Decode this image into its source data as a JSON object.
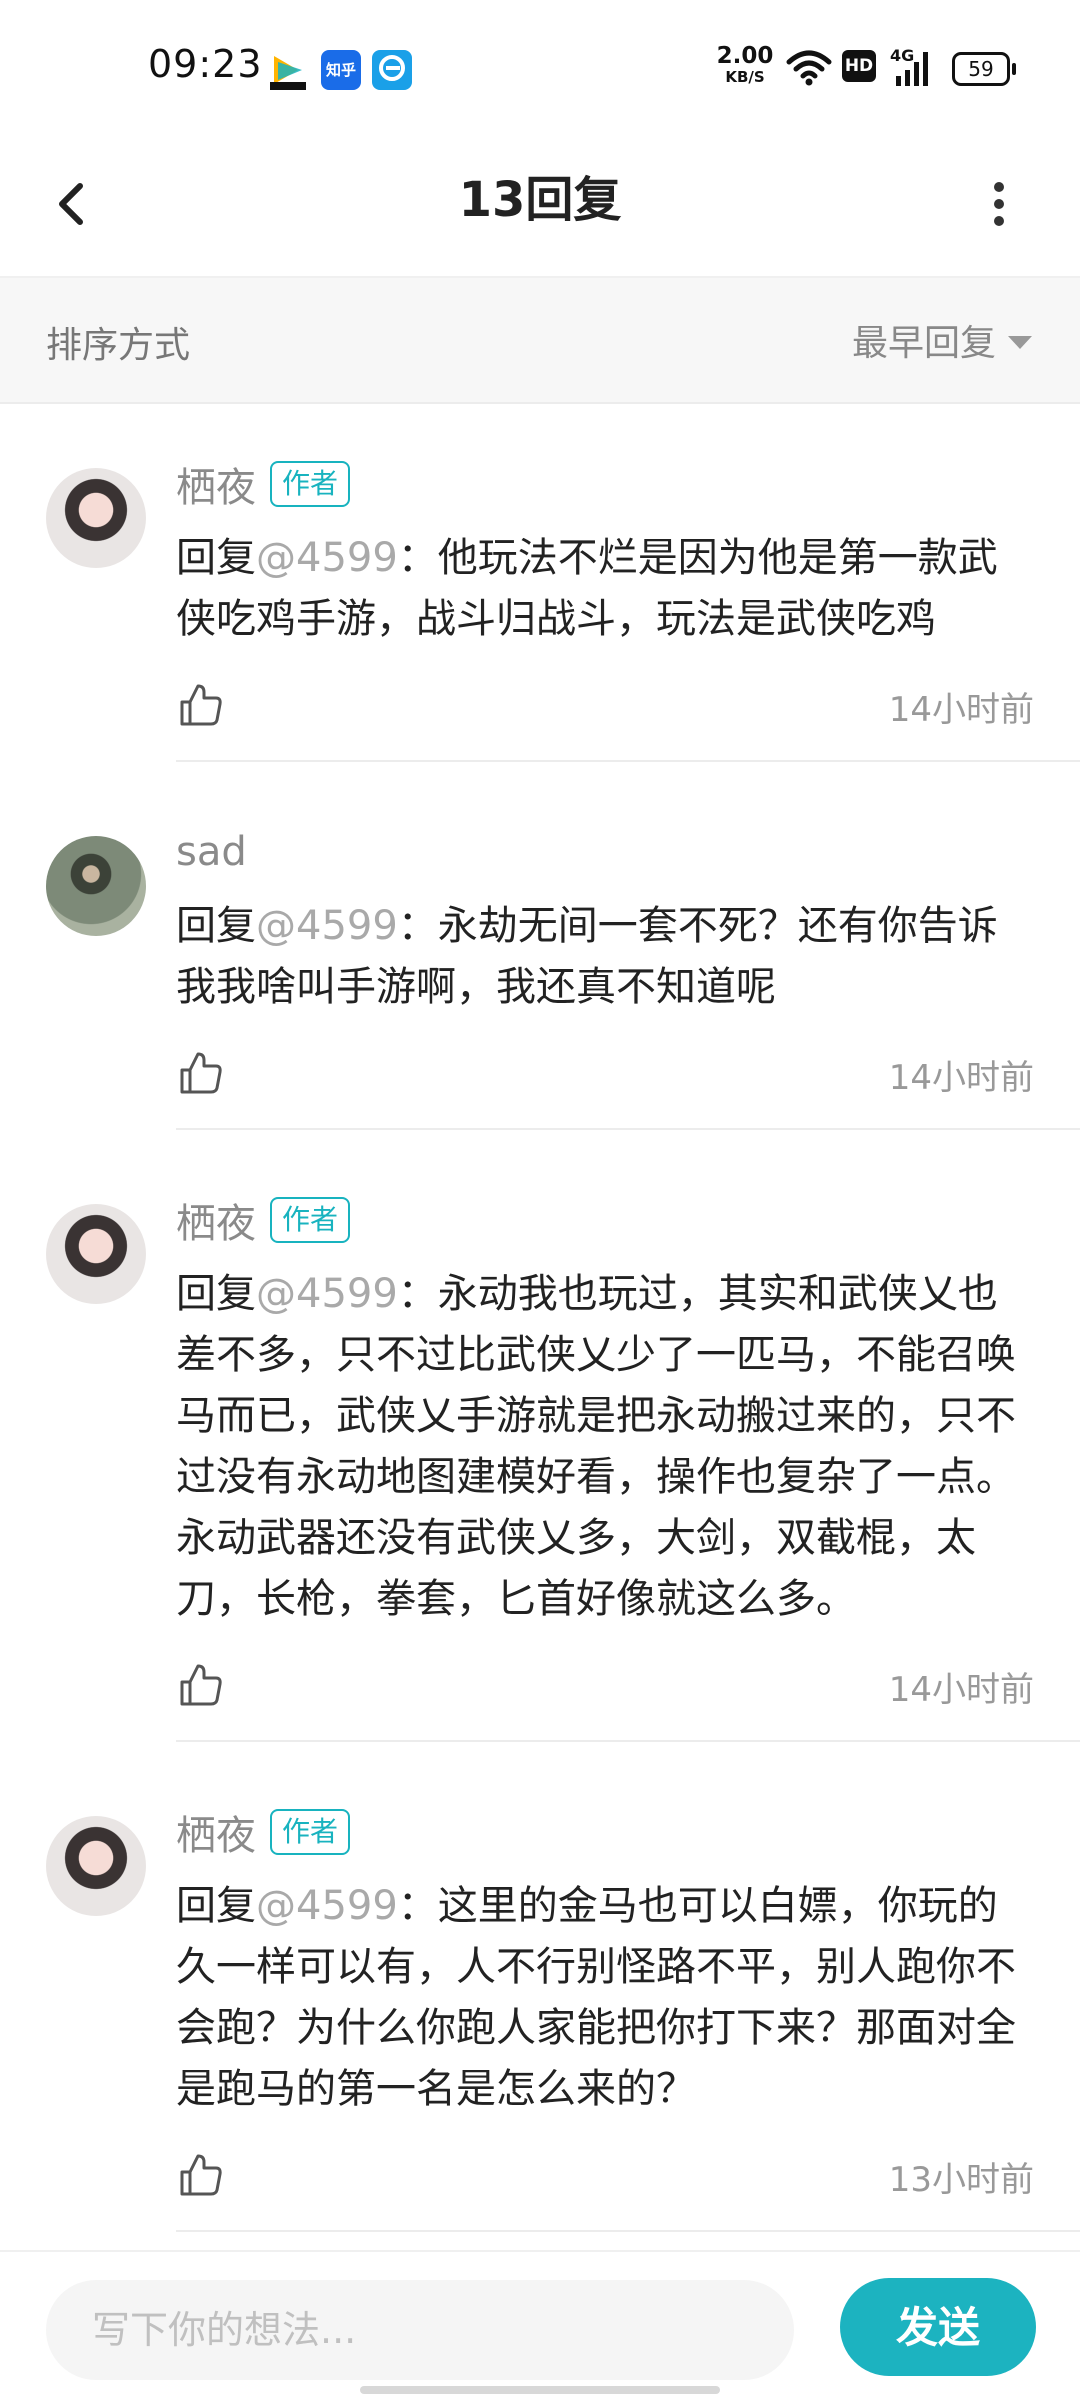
{
  "status_bar": {
    "time": "09:23",
    "apps": [
      {
        "icon": "video-app-icon"
      },
      {
        "icon": "zhihu-app-icon",
        "label": "知乎"
      },
      {
        "icon": "browser-app-icon"
      }
    ],
    "net_speed": "2.00",
    "net_unit": "KB/S",
    "hd": "HD",
    "signal": "4G",
    "battery": "59"
  },
  "header": {
    "title": "13回复",
    "back_icon": "back-arrow-icon",
    "more_icon": "more-vertical-icon"
  },
  "sort": {
    "label": "排序方式",
    "value": "最早回复"
  },
  "comments": [
    {
      "username": "栖夜",
      "badge": "作者",
      "reply_prefix": "回复",
      "mention": "@4599",
      "text": "：他玩法不烂是因为他是第一款武侠吃鸡手游，战斗归战斗，玩法是武侠吃鸡",
      "time": "14小时前"
    },
    {
      "username": "sad",
      "badge": "",
      "reply_prefix": "回复",
      "mention": "@4599",
      "text": "：永劫无间一套不死？还有你告诉我我啥叫手游啊，我还真不知道呢",
      "time": "14小时前"
    },
    {
      "username": "栖夜",
      "badge": "作者",
      "reply_prefix": "回复",
      "mention": "@4599",
      "text": "：永动我也玩过，其实和武侠乂也差不多，只不过比武侠乂少了一匹马，不能召唤马而已，武侠乂手游就是把永动搬过来的，只不过没有永动地图建模好看，操作也复杂了一点。永动武器还没有武侠乂多，大剑，双截棍，太刀，长枪，拳套，匕首好像就这么多。",
      "time": "14小时前"
    },
    {
      "username": "栖夜",
      "badge": "作者",
      "reply_prefix": "回复",
      "mention": "@4599",
      "text": "：这里的金马也可以白嫖，你玩的久一样可以有，人不行别怪路不平，别人跑你不会跑？为什么你跑人家能把你打下来？那面对全是跑马的第一名是怎么来的？",
      "time": "13小时前"
    }
  ],
  "input": {
    "placeholder": "写下你的想法...",
    "send_label": "发送"
  },
  "colors": {
    "accent": "#1cb3c0",
    "badge": "#18b3bf"
  }
}
